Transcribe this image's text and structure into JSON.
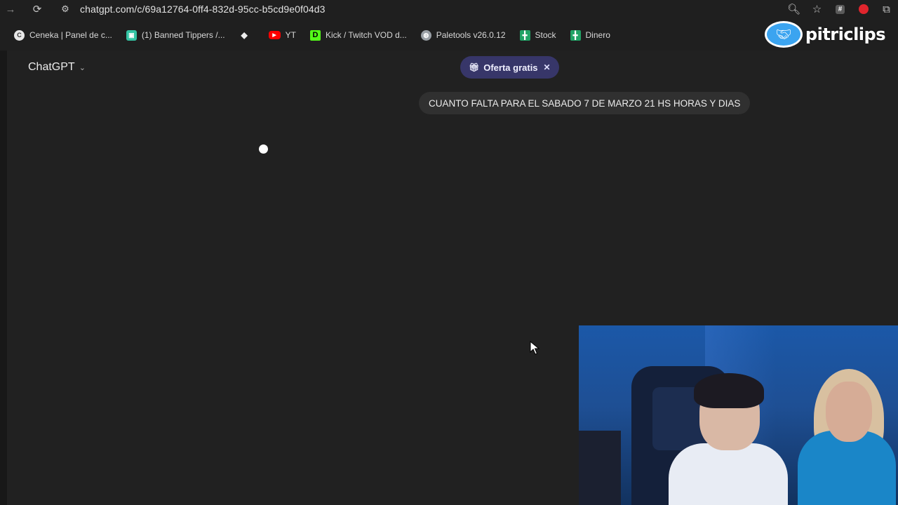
{
  "browser": {
    "url": "chatgpt.com/c/69a12764-0ff4-832d-95cc-b5cd9e0f04d3",
    "bookmarks": [
      {
        "label": "Ceneka | Panel de c...",
        "icon": "ceneka-icon"
      },
      {
        "label": "(1) Banned Tippers /...",
        "icon": "tippers-icon"
      },
      {
        "label": "",
        "icon": "diamond-icon"
      },
      {
        "label": "YT",
        "icon": "youtube-icon"
      },
      {
        "label": "Kick / Twitch VOD d...",
        "icon": "kick-icon"
      },
      {
        "label": "Paletools v26.0.12",
        "icon": "globe-icon"
      },
      {
        "label": "Stock",
        "icon": "sheets-icon"
      },
      {
        "label": "Dinero",
        "icon": "sheets-icon"
      }
    ]
  },
  "overlay": {
    "logo_text": "pitriclips"
  },
  "chat": {
    "model_label": "ChatGPT",
    "promo_label": "Oferta gratis",
    "user_message": "CUANTO FALTA PARA EL SABADO 7 DE MARZO 21 HS HORAS Y DIAS"
  },
  "colors": {
    "background": "#212121",
    "promo_bg": "#373669",
    "message_bg": "#303030"
  }
}
